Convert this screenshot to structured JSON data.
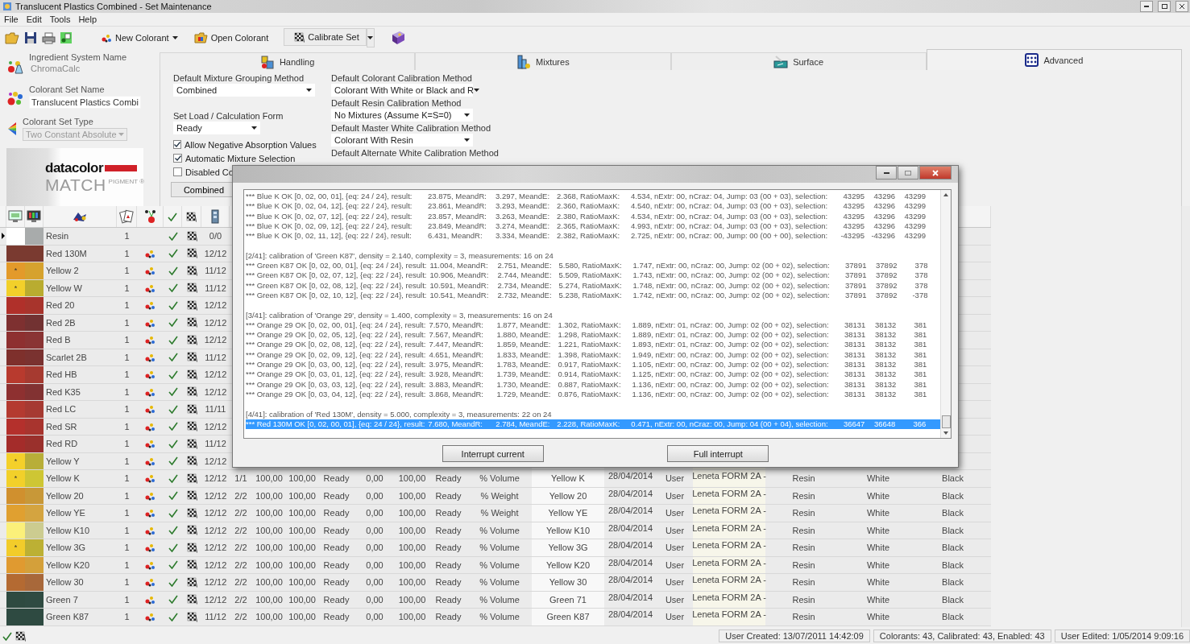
{
  "window": {
    "title": "Translucent Plastics Combined - Set Maintenance"
  },
  "menu": [
    "File",
    "Edit",
    "Tools",
    "Help"
  ],
  "toolbar": [
    {
      "label": "New Colorant",
      "kind": "menu"
    },
    {
      "label": "Open Colorant",
      "kind": "plain"
    },
    {
      "label": "Calibrate Set",
      "kind": "split"
    }
  ],
  "info": [
    {
      "label": "Ingredient System Name",
      "value": "ChromaCalc",
      "kind": "text"
    },
    {
      "label": "Colorant Set Name",
      "value": "Translucent Plastics Combi",
      "kind": "field"
    },
    {
      "label": "Colorant Set Type",
      "value": "Two Constant Absolute",
      "kind": "combo",
      "disabled": true
    }
  ],
  "logo": {
    "brand": "datacolor",
    "product": "MATCH",
    "sub": "PIGMENT ®"
  },
  "tabs": [
    {
      "label": "Handling",
      "selected": false
    },
    {
      "label": "Mixtures",
      "selected": false
    },
    {
      "label": "Surface",
      "selected": false
    },
    {
      "label": "Advanced",
      "selected": true
    }
  ],
  "settings": {
    "left": [
      {
        "kind": "combo",
        "label": "Default Mixture Grouping Method",
        "value": "Combined"
      },
      {
        "kind": "combo",
        "label": "Set Load / Calculation Form",
        "value": "Ready"
      },
      {
        "kind": "check",
        "label": "Allow Negative Absorption Values",
        "checked": true
      },
      {
        "kind": "check",
        "label": "Automatic Mixture Selection",
        "checked": true
      },
      {
        "kind": "check",
        "label": "Disabled Co",
        "checked": false
      },
      {
        "kind": "button",
        "label": "Combined"
      }
    ],
    "right": [
      {
        "kind": "combo",
        "label": "Default Colorant Calibration Method",
        "value": "Colorant With White or Black and R"
      },
      {
        "kind": "combo",
        "label": "Default Resin Calibration Method",
        "value": "No Mixtures (Assume K=S=0)"
      },
      {
        "kind": "combo",
        "label": "Default Master White Calibration Method",
        "value": "Colorant With Resin"
      },
      {
        "kind": "label",
        "label": "Default Alternate White Calibration Method"
      }
    ]
  },
  "rows": [
    {
      "current": true,
      "swatches": [
        {
          "color": "#ffffff"
        },
        {
          "color": "#a8abab"
        }
      ],
      "name": "Resin",
      "count": "1",
      "paint_icon": false,
      "fraction": "0/0"
    },
    {
      "current": false,
      "swatches": [
        {
          "color": "#7a3a30"
        },
        {
          "color": "#7a3a30"
        }
      ],
      "name": "Red 130M",
      "count": "1",
      "paint_icon": true,
      "fraction": "12/12"
    },
    {
      "current": false,
      "swatches": [
        {
          "color": "#e39a2a",
          "mark": "*"
        },
        {
          "color": "#d6a22e"
        }
      ],
      "name": "Yellow 2",
      "count": "1",
      "paint_icon": true,
      "fraction": "11/12"
    },
    {
      "current": false,
      "swatches": [
        {
          "color": "#f2d02a",
          "mark": "*"
        },
        {
          "color": "#b9ac30"
        }
      ],
      "name": "Yellow W",
      "count": "1",
      "paint_icon": true,
      "fraction": "11/12"
    },
    {
      "current": false,
      "swatches": [
        {
          "color": "#b0302a"
        },
        {
          "color": "#a8342c"
        }
      ],
      "name": "Red 20",
      "count": "1",
      "paint_icon": true,
      "fraction": "12/12"
    },
    {
      "current": false,
      "swatches": [
        {
          "color": "#7e3030"
        },
        {
          "color": "#723232"
        }
      ],
      "name": "Red 2B",
      "count": "1",
      "paint_icon": true,
      "fraction": "12/12"
    },
    {
      "current": false,
      "swatches": [
        {
          "color": "#8e3030"
        },
        {
          "color": "#8a3434"
        }
      ],
      "name": "Red B",
      "count": "1",
      "paint_icon": true,
      "fraction": "12/12"
    },
    {
      "current": false,
      "swatches": [
        {
          "color": "#7e302c"
        },
        {
          "color": "#7a3230"
        }
      ],
      "name": "Scarlet 2B",
      "count": "1",
      "paint_icon": true,
      "fraction": "11/12"
    },
    {
      "current": false,
      "swatches": [
        {
          "color": "#b83a2e"
        },
        {
          "color": "#a63a30"
        }
      ],
      "name": "Red HB",
      "count": "1",
      "paint_icon": true,
      "fraction": "12/12"
    },
    {
      "current": false,
      "swatches": [
        {
          "color": "#8e3030"
        },
        {
          "color": "#823232"
        }
      ],
      "name": "Red K35",
      "count": "1",
      "paint_icon": true,
      "fraction": "12/12"
    },
    {
      "current": false,
      "swatches": [
        {
          "color": "#b43a30"
        },
        {
          "color": "#a63a32"
        }
      ],
      "name": "Red LC",
      "count": "1",
      "paint_icon": true,
      "fraction": "11/11"
    },
    {
      "current": false,
      "swatches": [
        {
          "color": "#b4302c"
        },
        {
          "color": "#a8342e"
        }
      ],
      "name": "Red SR",
      "count": "1",
      "paint_icon": true,
      "fraction": "12/12"
    },
    {
      "current": false,
      "swatches": [
        {
          "color": "#a42c2a"
        },
        {
          "color": "#9a302c"
        }
      ],
      "name": "Red RD",
      "count": "1",
      "paint_icon": true,
      "fraction": "11/12"
    },
    {
      "current": false,
      "swatches": [
        {
          "color": "#f4d02a",
          "mark": "*"
        },
        {
          "color": "#b8ae38"
        }
      ],
      "name": "Yellow Y",
      "count": "1",
      "paint_icon": true,
      "fraction": "12/12"
    },
    {
      "current": false,
      "swatches": [
        {
          "color": "#f2d02a",
          "mark": "*"
        },
        {
          "color": "#cec634"
        }
      ],
      "name": "Yellow K",
      "count": "1",
      "paint_icon": true,
      "fraction": "12/12",
      "cells": [
        "1/1",
        "100,00",
        "100,00",
        "Ready",
        "0,00",
        "100,00",
        "Ready",
        "% Volume",
        "Yellow K",
        "28/04/2014",
        "User",
        "Leneta FORM 2A -",
        "Resin",
        "White",
        "Black"
      ]
    },
    {
      "current": false,
      "swatches": [
        {
          "color": "#d0902e"
        },
        {
          "color": "#c89838"
        }
      ],
      "name": "Yellow 20",
      "count": "1",
      "paint_icon": true,
      "fraction": "12/12",
      "cells": [
        "2/2",
        "100,00",
        "100,00",
        "Ready",
        "0,00",
        "100,00",
        "Ready",
        "% Weight",
        "Yellow 20",
        "28/04/2014",
        "User",
        "Leneta FORM 2A -",
        "Resin",
        "White",
        "Black"
      ]
    },
    {
      "current": false,
      "swatches": [
        {
          "color": "#e0a030"
        },
        {
          "color": "#d4a440"
        }
      ],
      "name": "Yellow YE",
      "count": "1",
      "paint_icon": true,
      "fraction": "12/12",
      "cells": [
        "2/2",
        "100,00",
        "100,00",
        "Ready",
        "0,00",
        "100,00",
        "Ready",
        "% Weight",
        "Yellow YE",
        "28/04/2014",
        "User",
        "Leneta FORM 2A -",
        "Resin",
        "White",
        "Black"
      ]
    },
    {
      "current": false,
      "swatches": [
        {
          "color": "#fbf07a"
        },
        {
          "color": "#cccc90"
        }
      ],
      "name": "Yellow K10",
      "count": "1",
      "paint_icon": true,
      "fraction": "12/12",
      "cells": [
        "2/2",
        "100,00",
        "100,00",
        "Ready",
        "0,00",
        "100,00",
        "Ready",
        "% Volume",
        "Yellow K10",
        "28/04/2014",
        "User",
        "Leneta FORM 2A -",
        "Resin",
        "White",
        "Black"
      ]
    },
    {
      "current": false,
      "swatches": [
        {
          "color": "#f2cc2a",
          "mark": "*"
        },
        {
          "color": "#bcb034"
        }
      ],
      "name": "Yellow 3G",
      "count": "1",
      "paint_icon": true,
      "fraction": "12/12",
      "cells": [
        "2/2",
        "100,00",
        "100,00",
        "Ready",
        "0,00",
        "100,00",
        "Ready",
        "% Volume",
        "Yellow 3G",
        "28/04/2014",
        "User",
        "Leneta FORM 2A -",
        "Resin",
        "White",
        "Black"
      ]
    },
    {
      "current": false,
      "swatches": [
        {
          "color": "#e09a30"
        },
        {
          "color": "#d4a03a"
        }
      ],
      "name": "Yellow K20",
      "count": "1",
      "paint_icon": true,
      "fraction": "12/12",
      "cells": [
        "2/2",
        "100,00",
        "100,00",
        "Ready",
        "0,00",
        "100,00",
        "Ready",
        "% Volume",
        "Yellow K20",
        "28/04/2014",
        "User",
        "Leneta FORM 2A -",
        "Resin",
        "White",
        "Black"
      ]
    },
    {
      "current": false,
      "swatches": [
        {
          "color": "#b46a32"
        },
        {
          "color": "#a8683a"
        }
      ],
      "name": "Yellow 30",
      "count": "1",
      "paint_icon": true,
      "fraction": "12/12",
      "cells": [
        "2/2",
        "100,00",
        "100,00",
        "Ready",
        "0,00",
        "100,00",
        "Ready",
        "% Volume",
        "Yellow 30",
        "28/04/2014",
        "User",
        "Leneta FORM 2A -",
        "Resin",
        "White",
        "Black"
      ]
    },
    {
      "current": false,
      "swatches": [
        {
          "color": "#2e4a40"
        },
        {
          "color": "#2f4b42"
        }
      ],
      "name": "Green 7",
      "count": "1",
      "paint_icon": true,
      "fraction": "12/12",
      "cells": [
        "2/2",
        "100,00",
        "100,00",
        "Ready",
        "0,00",
        "100,00",
        "Ready",
        "% Volume",
        "Green 71",
        "28/04/2014",
        "User",
        "Leneta FORM 2A -",
        "Resin",
        "White",
        "Black"
      ]
    },
    {
      "current": false,
      "swatches": [
        {
          "color": "#2e4a41"
        },
        {
          "color": "#2e4a41"
        }
      ],
      "name": "Green K87",
      "count": "1",
      "paint_icon": true,
      "fraction": "11/12",
      "cells": [
        "2/2",
        "100,00",
        "100,00",
        "Ready",
        "0,00",
        "100,00",
        "Ready",
        "% Volume",
        "Green K87",
        "28/04/2014",
        "User",
        "Leneta FORM 2A -",
        "Resin",
        "White",
        "Black"
      ]
    }
  ],
  "dialog": {
    "log": [
      {
        "kind": "entry",
        "selected": false,
        "fields": [
          "*** Blue K OK [0, 02, 00, 01], {eq: 24 / 24}, result:",
          "23.875, MeandR:",
          "3.297, MeandE:",
          "2.368, RatioMaxK:",
          "4.534, nExtr: 00, nCraz: 04, Jump: 03 (00 + 03), selection:",
          "43295",
          "43296",
          "43299"
        ]
      },
      {
        "kind": "entry",
        "selected": false,
        "fields": [
          "*** Blue K OK [0, 02, 04, 12], {eq: 22 / 24}, result:",
          "23.861, MeandR:",
          "3.293, MeandE:",
          "2.360, RatioMaxK:",
          "4.540, nExtr: 00, nCraz: 04, Jump: 03 (00 + 03), selection:",
          "43295",
          "43296",
          "43299"
        ]
      },
      {
        "kind": "entry",
        "selected": false,
        "fields": [
          "*** Blue K OK [0, 02, 07, 12], {eq: 22 / 24}, result:",
          "23.857, MeandR:",
          "3.263, MeandE:",
          "2.380, RatioMaxK:",
          "4.534, nExtr: 00, nCraz: 04, Jump: 03 (00 + 03), selection:",
          "43295",
          "43296",
          "43299"
        ]
      },
      {
        "kind": "entry",
        "selected": false,
        "fields": [
          "*** Blue K OK [0, 02, 09, 12], {eq: 22 / 24}, result:",
          "23.849, MeandR:",
          "3.274, MeandE:",
          "2.365, RatioMaxK:",
          "4.993, nExtr: 00, nCraz: 04, Jump: 03 (00 + 03), selection:",
          "43295",
          "43296",
          "43299"
        ]
      },
      {
        "kind": "entry",
        "selected": false,
        "fields": [
          "*** Blue K OK [0, 02, 11, 12], {eq: 22 / 24}, result:",
          "6.431, MeandR:",
          "3.334, MeandE:",
          "2.382, RatioMaxK:",
          "2.725, nExtr: 00, nCraz: 00, Jump: 00 (00 + 00), selection:",
          "-43295",
          "-43296",
          "43299"
        ]
      },
      {
        "kind": "header",
        "selected": false,
        "text": "[2/41]: calibration of 'Green K87', density = 2.140, complexity = 3, measurements: 16 on 24"
      },
      {
        "kind": "entry",
        "selected": false,
        "fields": [
          "*** Green K87 OK [0, 02, 00, 01], {eq: 24 / 24}, result:",
          "11.004, MeandR:",
          "2.751, MeandE:",
          "5.580, RatioMaxK:",
          "1.747, nExtr: 00, nCraz: 00, Jump: 02 (00 + 02), selection:",
          "37891",
          "37892",
          "378"
        ]
      },
      {
        "kind": "entry",
        "selected": false,
        "fields": [
          "*** Green K87 OK [0, 02, 07, 12], {eq: 22 / 24}, result:",
          "10.906, MeandR:",
          "2.744, MeandE:",
          "5.509, RatioMaxK:",
          "1.743, nExtr: 00, nCraz: 00, Jump: 02 (00 + 02), selection:",
          "37891",
          "37892",
          "378"
        ]
      },
      {
        "kind": "entry",
        "selected": false,
        "fields": [
          "*** Green K87 OK [0, 02, 08, 12], {eq: 22 / 24}, result:",
          "10.591, MeandR:",
          "2.734, MeandE:",
          "5.274, RatioMaxK:",
          "1.748, nExtr: 00, nCraz: 00, Jump: 02 (00 + 02), selection:",
          "37891",
          "37892",
          "378"
        ]
      },
      {
        "kind": "entry",
        "selected": false,
        "fields": [
          "*** Green K87 OK [0, 02, 10, 12], {eq: 22 / 24}, result:",
          "10.541, MeandR:",
          "2.732, MeandE:",
          "5.238, RatioMaxK:",
          "1.742, nExtr: 00, nCraz: 00, Jump: 02 (00 + 02), selection:",
          "37891",
          "37892",
          "-378"
        ]
      },
      {
        "kind": "header",
        "selected": false,
        "text": "[3/41]: calibration of 'Orange 29', density = 1.400, complexity = 3, measurements: 16 on 24"
      },
      {
        "kind": "entry",
        "selected": false,
        "fields": [
          "*** Orange 29 OK [0, 02, 00, 01], {eq: 24 / 24}, result:",
          "7.570, MeandR:",
          "1.877, MeandE:",
          "1.302, RatioMaxK:",
          "1.889, nExtr: 01, nCraz: 00, Jump: 02 (00 + 02), selection:",
          "38131",
          "38132",
          "381"
        ]
      },
      {
        "kind": "entry",
        "selected": false,
        "fields": [
          "*** Orange 29 OK [0, 02, 05, 12], {eq: 22 / 24}, result:",
          "7.567, MeandR:",
          "1.880, MeandE:",
          "1.298, RatioMaxK:",
          "1.889, nExtr: 01, nCraz: 00, Jump: 02 (00 + 02), selection:",
          "38131",
          "38132",
          "381"
        ]
      },
      {
        "kind": "entry",
        "selected": false,
        "fields": [
          "*** Orange 29 OK [0, 02, 08, 12], {eq: 22 / 24}, result:",
          "7.447, MeandR:",
          "1.859, MeandE:",
          "1.221, RatioMaxK:",
          "1.893, nExtr: 01, nCraz: 00, Jump: 02 (00 + 02), selection:",
          "38131",
          "38132",
          "381"
        ]
      },
      {
        "kind": "entry",
        "selected": false,
        "fields": [
          "*** Orange 29 OK [0, 02, 09, 12], {eq: 22 / 24}, result:",
          "4.651, MeandR:",
          "1.833, MeandE:",
          "1.398, RatioMaxK:",
          "1.949, nExtr: 00, nCraz: 00, Jump: 02 (00 + 02), selection:",
          "38131",
          "38132",
          "381"
        ]
      },
      {
        "kind": "entry",
        "selected": false,
        "fields": [
          "*** Orange 29 OK [0, 03, 00, 12], {eq: 22 / 24}, result:",
          "3.975, MeandR:",
          "1.783, MeandE:",
          "0.917, RatioMaxK:",
          "1.105, nExtr: 00, nCraz: 00, Jump: 02 (00 + 02), selection:",
          "38131",
          "38132",
          "381"
        ]
      },
      {
        "kind": "entry",
        "selected": false,
        "fields": [
          "*** Orange 29 OK [0, 03, 01, 12], {eq: 22 / 24}, result:",
          "3.928, MeandR:",
          "1.739, MeandE:",
          "0.914, RatioMaxK:",
          "1.125, nExtr: 00, nCraz: 00, Jump: 02 (00 + 02), selection:",
          "38131",
          "38132",
          "381"
        ]
      },
      {
        "kind": "entry",
        "selected": false,
        "fields": [
          "*** Orange 29 OK [0, 03, 03, 12], {eq: 22 / 24}, result:",
          "3.883, MeandR:",
          "1.730, MeandE:",
          "0.887, RatioMaxK:",
          "1.136, nExtr: 00, nCraz: 00, Jump: 02 (00 + 02), selection:",
          "38131",
          "38132",
          "381"
        ]
      },
      {
        "kind": "entry",
        "selected": false,
        "fields": [
          "*** Orange 29 OK [0, 03, 04, 12], {eq: 22 / 24}, result:",
          "3.868, MeandR:",
          "1.729, MeandE:",
          "0.876, RatioMaxK:",
          "1.136, nExtr: 00, nCraz: 00, Jump: 02 (00 + 02), selection:",
          "38131",
          "38132",
          "381"
        ]
      },
      {
        "kind": "header",
        "selected": false,
        "text": "[4/41]: calibration of 'Red 130M', density = 5.000, complexity = 3, measurements: 22 on 24"
      },
      {
        "kind": "entry",
        "selected": true,
        "fields": [
          "*** Red 130M OK [0, 02, 00, 01], {eq: 24 / 24}, result:",
          "7.680, MeandR:",
          "2.784, MeandE:",
          "2.228, RatioMaxK:",
          "0.471, nExtr: 00, nCraz: 00, Jump: 04 (00 + 04), selection:",
          "36647",
          "36648",
          "366"
        ]
      }
    ],
    "buttons": [
      "Interrupt current",
      "Full interrupt"
    ]
  },
  "status_bar": [
    "User Created: 13/07/2011 14:42:09",
    "Colorants: 43,  Calibrated: 43,  Enabled: 43",
    "User Edited: 1/05/2014 9:09:16"
  ]
}
